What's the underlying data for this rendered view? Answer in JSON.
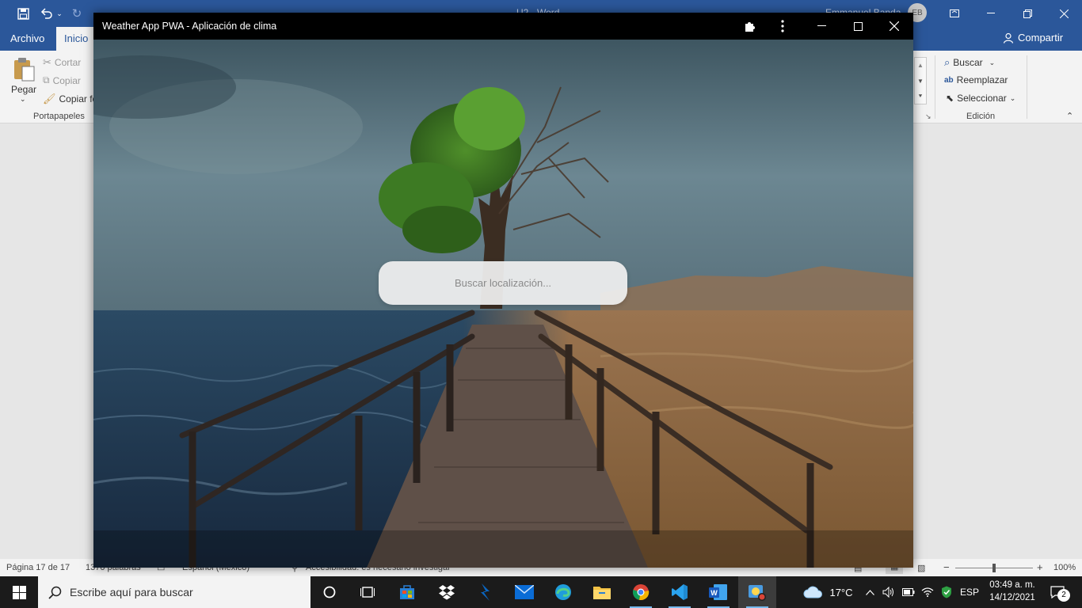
{
  "word": {
    "doc_title": "U2 - Word",
    "user_name": "Emmanuel Banda",
    "user_initials": "EB",
    "tabs": [
      "Archivo",
      "Inicio"
    ],
    "share_label": "Compartir",
    "clipboard": {
      "paste": "Pegar",
      "cut": "Cortar",
      "copy": "Copiar",
      "format_painter": "Copiar fo",
      "group_label": "Portapapeles"
    },
    "editing": {
      "find": "Buscar",
      "replace": "Reemplazar",
      "select": "Seleccionar",
      "group_label": "Edición"
    },
    "status": {
      "page": "Página 17 de 17",
      "words": "1370 palabras",
      "language": "Español (México)",
      "accessibility": "Accesibilidad: es necesario investigar",
      "zoom": "100%"
    }
  },
  "pwa": {
    "title": "Weather App PWA - Aplicación de clima",
    "search_placeholder": "Buscar localización..."
  },
  "taskbar": {
    "search_placeholder": "Escribe aquí para buscar",
    "temperature": "17°C",
    "language": "ESP",
    "time": "03:49 a. m.",
    "date": "14/12/2021",
    "notification_count": "2"
  }
}
